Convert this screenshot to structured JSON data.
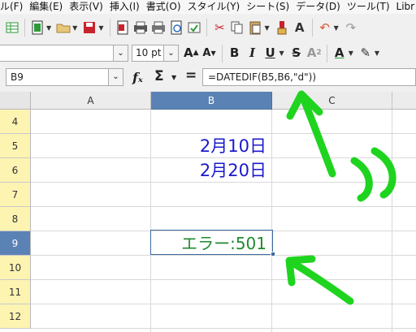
{
  "menu": [
    "ル(F)",
    "編集(E)",
    "表示(V)",
    "挿入(I)",
    "書式(O)",
    "スタイル(Y)",
    "シート(S)",
    "データ(D)",
    "ツール(T)",
    "Libr"
  ],
  "toolbar2": {
    "font_size": "10 pt"
  },
  "formula_bar": {
    "name_box": "B9",
    "fx": "fₓ",
    "sigma": "Σ",
    "equals": "=",
    "formula": "=DATEDIF(B5,B6,\"d\"))"
  },
  "columns": [
    "A",
    "B",
    "C"
  ],
  "rows": [
    "4",
    "5",
    "6",
    "7",
    "8",
    "9",
    "10",
    "11",
    "12"
  ],
  "cells": {
    "B5": "2月10日",
    "B6": "2月20日",
    "B9": "エラー:501"
  },
  "colors": {
    "date_text": "#1a1acc",
    "error_text": "#1f8a2e",
    "selection": "#5b82b5",
    "row_header_bg": "#fdf4b2",
    "annotation": "#1fd41f"
  }
}
